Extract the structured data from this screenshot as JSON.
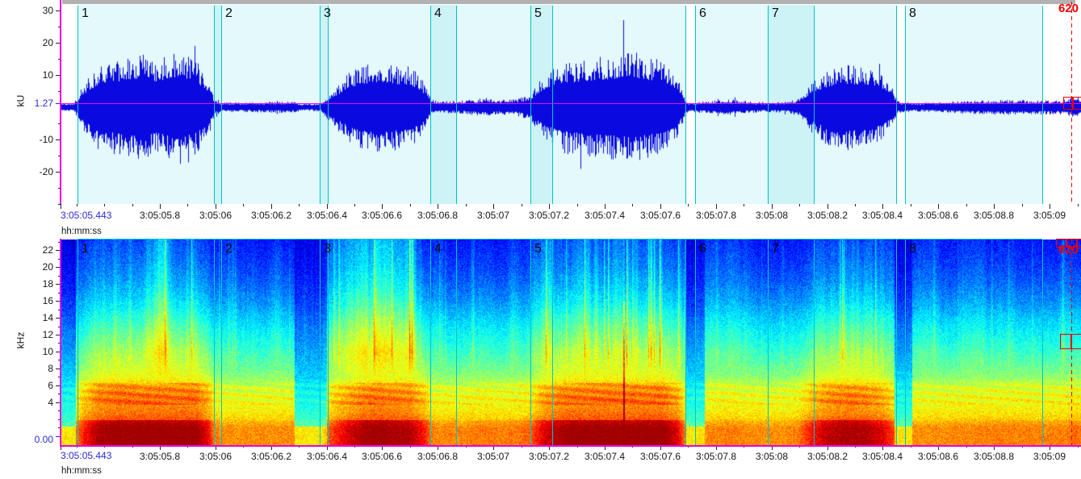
{
  "panels": {
    "waveform": {
      "y_axis_label": "kU",
      "y_ticks": [
        {
          "v": 30,
          "label": "30"
        },
        {
          "v": 20,
          "label": "20"
        },
        {
          "v": 10,
          "label": "10"
        },
        {
          "v": -10,
          "label": "-10"
        },
        {
          "v": -20,
          "label": "-20"
        }
      ],
      "y_minor_ticks": [
        25,
        15,
        5,
        -5,
        -15,
        -25,
        -30
      ],
      "cursor_label": "1.27",
      "cursor_value": 1.27,
      "marker_label": "620"
    },
    "spectrogram": {
      "y_axis_label": "kHz",
      "y_ticks": [
        {
          "v": 22,
          "label": "22"
        },
        {
          "v": 20,
          "label": "20"
        },
        {
          "v": 18,
          "label": "18"
        },
        {
          "v": 16,
          "label": "16"
        },
        {
          "v": 14,
          "label": "14"
        },
        {
          "v": 12,
          "label": "12"
        },
        {
          "v": 10,
          "label": "10"
        },
        {
          "v": 8,
          "label": "8"
        },
        {
          "v": 6,
          "label": "6"
        },
        {
          "v": 4,
          "label": "4"
        }
      ],
      "y_minor_ticks": [
        23,
        21,
        19,
        17,
        15,
        13,
        11,
        9,
        7,
        5,
        3,
        2,
        1
      ],
      "cursor_label": "0.00",
      "cursor_value": 0.0,
      "marker_label": "620"
    }
  },
  "time_axis": {
    "cursor_time_label": "3:05:05.443",
    "unit_label": "hh:mm:ss",
    "ticks": [
      {
        "t": 5.8,
        "label": "3:05:05.8"
      },
      {
        "t": 6.0,
        "label": "3:05:06"
      },
      {
        "t": 6.2,
        "label": "3:05:06.2"
      },
      {
        "t": 6.4,
        "label": "3:05:06.4"
      },
      {
        "t": 6.6,
        "label": "3:05:06.6"
      },
      {
        "t": 6.8,
        "label": "3:05:06.8"
      },
      {
        "t": 7.0,
        "label": "3:05:07"
      },
      {
        "t": 7.2,
        "label": "3:05:07.2"
      },
      {
        "t": 7.4,
        "label": "3:05:07.4"
      },
      {
        "t": 7.6,
        "label": "3:05:07.6"
      },
      {
        "t": 7.8,
        "label": "3:05:07.8"
      },
      {
        "t": 8.0,
        "label": "3:05:08"
      },
      {
        "t": 8.2,
        "label": "3:05:08.2"
      },
      {
        "t": 8.4,
        "label": "3:05:08.4"
      },
      {
        "t": 8.6,
        "label": "3:05:08.6"
      },
      {
        "t": 8.8,
        "label": "3:05:08.8"
      },
      {
        "t": 9.0,
        "label": "3:05:09"
      }
    ]
  },
  "chart_data": {
    "type": "waveform+spectrogram",
    "time_axis": {
      "start_s": 5.443,
      "end_s": 9.113,
      "start_label": "3:05:05.443",
      "tick_interval_s": 0.2,
      "unit": "hh:mm:ss"
    },
    "waveform": {
      "ylabel": "kU",
      "ylim": [
        -30,
        31.75
      ],
      "cursor_level_kU": 1.27,
      "envelope_kU": [
        [
          5.443,
          1.2
        ],
        [
          5.49,
          1.2
        ],
        [
          5.53,
          7
        ],
        [
          5.58,
          12
        ],
        [
          5.66,
          13.5
        ],
        [
          5.73,
          15
        ],
        [
          5.79,
          13
        ],
        [
          5.87,
          16
        ],
        [
          5.93,
          13
        ],
        [
          5.975,
          8
        ],
        [
          5.995,
          2.2
        ],
        [
          6.02,
          1.3
        ],
        [
          6.15,
          1.4
        ],
        [
          6.27,
          1.6
        ],
        [
          6.32,
          0.9
        ],
        [
          6.38,
          1.2
        ],
        [
          6.42,
          5
        ],
        [
          6.47,
          9
        ],
        [
          6.53,
          12
        ],
        [
          6.58,
          13
        ],
        [
          6.64,
          12
        ],
        [
          6.7,
          11.5
        ],
        [
          6.75,
          7
        ],
        [
          6.775,
          2.2
        ],
        [
          6.8,
          1.6
        ],
        [
          6.9,
          1.9
        ],
        [
          6.97,
          2.6
        ],
        [
          7.02,
          2.1
        ],
        [
          7.08,
          2.3
        ],
        [
          7.13,
          3.5
        ],
        [
          7.18,
          9
        ],
        [
          7.24,
          12
        ],
        [
          7.32,
          13.5
        ],
        [
          7.42,
          14.5
        ],
        [
          7.5,
          15.5
        ],
        [
          7.56,
          14
        ],
        [
          7.62,
          12.5
        ],
        [
          7.66,
          9
        ],
        [
          7.685,
          3
        ],
        [
          7.7,
          1.4
        ],
        [
          7.78,
          1.7
        ],
        [
          7.84,
          2.4
        ],
        [
          7.9,
          1.7
        ],
        [
          7.97,
          1.4
        ],
        [
          8.05,
          1.5
        ],
        [
          8.1,
          2.5
        ],
        [
          8.14,
          7
        ],
        [
          8.2,
          10.5
        ],
        [
          8.27,
          12
        ],
        [
          8.34,
          11.5
        ],
        [
          8.4,
          9
        ],
        [
          8.435,
          5
        ],
        [
          8.455,
          1.6
        ],
        [
          8.52,
          1.2
        ],
        [
          8.62,
          1.5
        ],
        [
          8.72,
          1.9
        ],
        [
          8.82,
          2.1
        ],
        [
          8.92,
          2
        ],
        [
          9.0,
          1.9
        ],
        [
          9.06,
          2.2
        ],
        [
          9.09,
          3.2
        ],
        [
          9.113,
          2.5
        ]
      ],
      "peak_spike": {
        "t": 7.468,
        "amp_kU": 27
      }
    },
    "spectrogram": {
      "ylabel": "kHz",
      "flim_kHz": [
        0,
        23.2
      ],
      "colormap": "jet",
      "cursor_level_kHz": 0.0,
      "calls_s": [
        [
          5.5,
          5.99
        ],
        [
          6.4,
          6.78
        ],
        [
          7.13,
          7.69
        ],
        [
          8.1,
          8.44
        ]
      ],
      "quiet_s": [
        [
          5.443,
          5.498
        ],
        [
          6.285,
          6.4
        ],
        [
          7.688,
          7.758
        ],
        [
          8.44,
          8.505
        ]
      ],
      "hot_streaks_s": [
        7.468
      ],
      "base_intensity_by_kHz": [
        [
          0,
          0.8
        ],
        [
          1,
          0.8
        ],
        [
          2,
          0.74
        ],
        [
          3,
          0.7
        ],
        [
          4,
          0.68
        ],
        [
          5,
          0.66
        ],
        [
          6,
          0.63
        ],
        [
          7,
          0.57
        ],
        [
          8,
          0.52
        ],
        [
          9,
          0.48
        ],
        [
          10,
          0.44
        ],
        [
          11,
          0.41
        ],
        [
          12,
          0.385
        ],
        [
          13,
          0.355
        ],
        [
          14,
          0.325
        ],
        [
          15,
          0.29
        ],
        [
          16,
          0.26
        ],
        [
          18,
          0.21
        ],
        [
          20,
          0.17
        ],
        [
          22,
          0.14
        ],
        [
          23.5,
          0.12
        ]
      ]
    },
    "annotations": {
      "selection_span_s": [
        5.504,
        8.974
      ],
      "boundaries_s": [
        5.504,
        5.995,
        6.021,
        6.375,
        6.404,
        6.773,
        6.866,
        7.133,
        7.211,
        7.69,
        7.725,
        7.986,
        8.152,
        8.448,
        8.48,
        8.974
      ],
      "white_gaps_s": [
        [
          7.69,
          7.725
        ],
        [
          8.448,
          8.48
        ]
      ],
      "shaded_bands_s": [
        [
          5.995,
          6.021
        ],
        [
          6.375,
          6.404
        ],
        [
          6.773,
          6.866
        ],
        [
          7.133,
          7.211
        ],
        [
          7.986,
          8.152
        ]
      ],
      "segments": [
        {
          "label": "1",
          "t": 5.504
        },
        {
          "label": "2",
          "t": 6.021
        },
        {
          "label": "3",
          "t": 6.375
        },
        {
          "label": "4",
          "t": 6.773
        },
        {
          "label": "5",
          "t": 7.133
        },
        {
          "label": "6",
          "t": 7.725
        },
        {
          "label": "7",
          "t": 7.986
        },
        {
          "label": "8",
          "t": 8.48
        }
      ],
      "event_marker": {
        "label": "620",
        "t": 9.078
      }
    },
    "colors": {
      "waveform": "#0a0ae0",
      "selection_bg": "#e3f9fb",
      "shaded_band": "#cdf3f7",
      "boundary_line": "#00c5cd",
      "cursor_line": "#fa00fa",
      "event_marker": "#ee0000",
      "axis_cursor_text": "#2a2ad0"
    }
  }
}
